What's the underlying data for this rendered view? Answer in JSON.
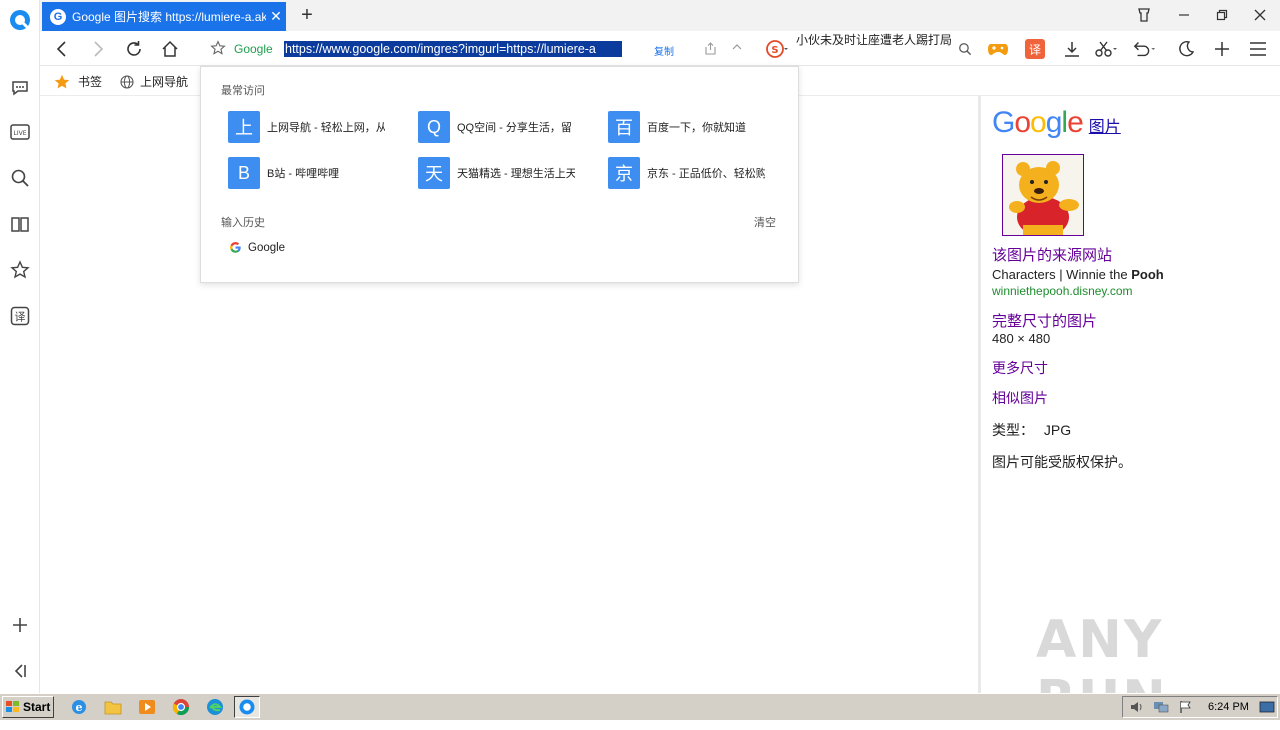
{
  "tab": {
    "title": "Google 图片搜索 https://lumiere-a.akamaihd.net"
  },
  "address": {
    "engine": "Google",
    "url": "https://www.google.com/imgres?imgurl=https://lumiere-a",
    "copy_label": "复制",
    "hot_search": "小伙未及时让座遭老人踢打局"
  },
  "bookmarks": [
    {
      "label": "书签",
      "icon": "star-icon"
    },
    {
      "label": "上网导航",
      "icon": "globe-icon"
    }
  ],
  "dropdown": {
    "frequent_title": "最常访问",
    "sites": [
      {
        "tile": "上",
        "label": "上网导航 - 轻松上网，从"
      },
      {
        "tile": "Q",
        "label": "QQ空间 - 分享生活，留"
      },
      {
        "tile": "百",
        "label": "百度一下，你就知道"
      },
      {
        "tile": "B",
        "label": "B站 - 哔哩哔哩"
      },
      {
        "tile": "天",
        "label": "天猫精选 - 理想生活上天"
      },
      {
        "tile": "京",
        "label": "京东 - 正品低价、轻松购"
      }
    ],
    "history_title": "输入历史",
    "clear_label": "清空",
    "history_item": "Google"
  },
  "panel": {
    "logo": "Google",
    "images_link": "图片",
    "source_site_link": "该图片的来源网站",
    "page_title_prefix": "Characters | Winnie the ",
    "page_title_bold": "Pooh",
    "domain": "winniethepooh.disney.com",
    "full_size_link": "完整尺寸的图片",
    "dimensions": "480 × 480",
    "more_sizes_link": "更多尺寸",
    "similar_link": "相似图片",
    "type_label": "类型：",
    "type_value": "JPG",
    "copyright_note": "图片可能受版权保护。"
  },
  "watermark": "ANY RUN",
  "taskbar": {
    "start_label": "Start",
    "clock": "6:24 PM"
  },
  "colors": {
    "tab_blue": "#1a73e8",
    "tile_blue": "#3d8ef0",
    "url_highlight": "#0b3b9c",
    "visited_purple": "#660099",
    "green_url": "#1e8c2e"
  }
}
